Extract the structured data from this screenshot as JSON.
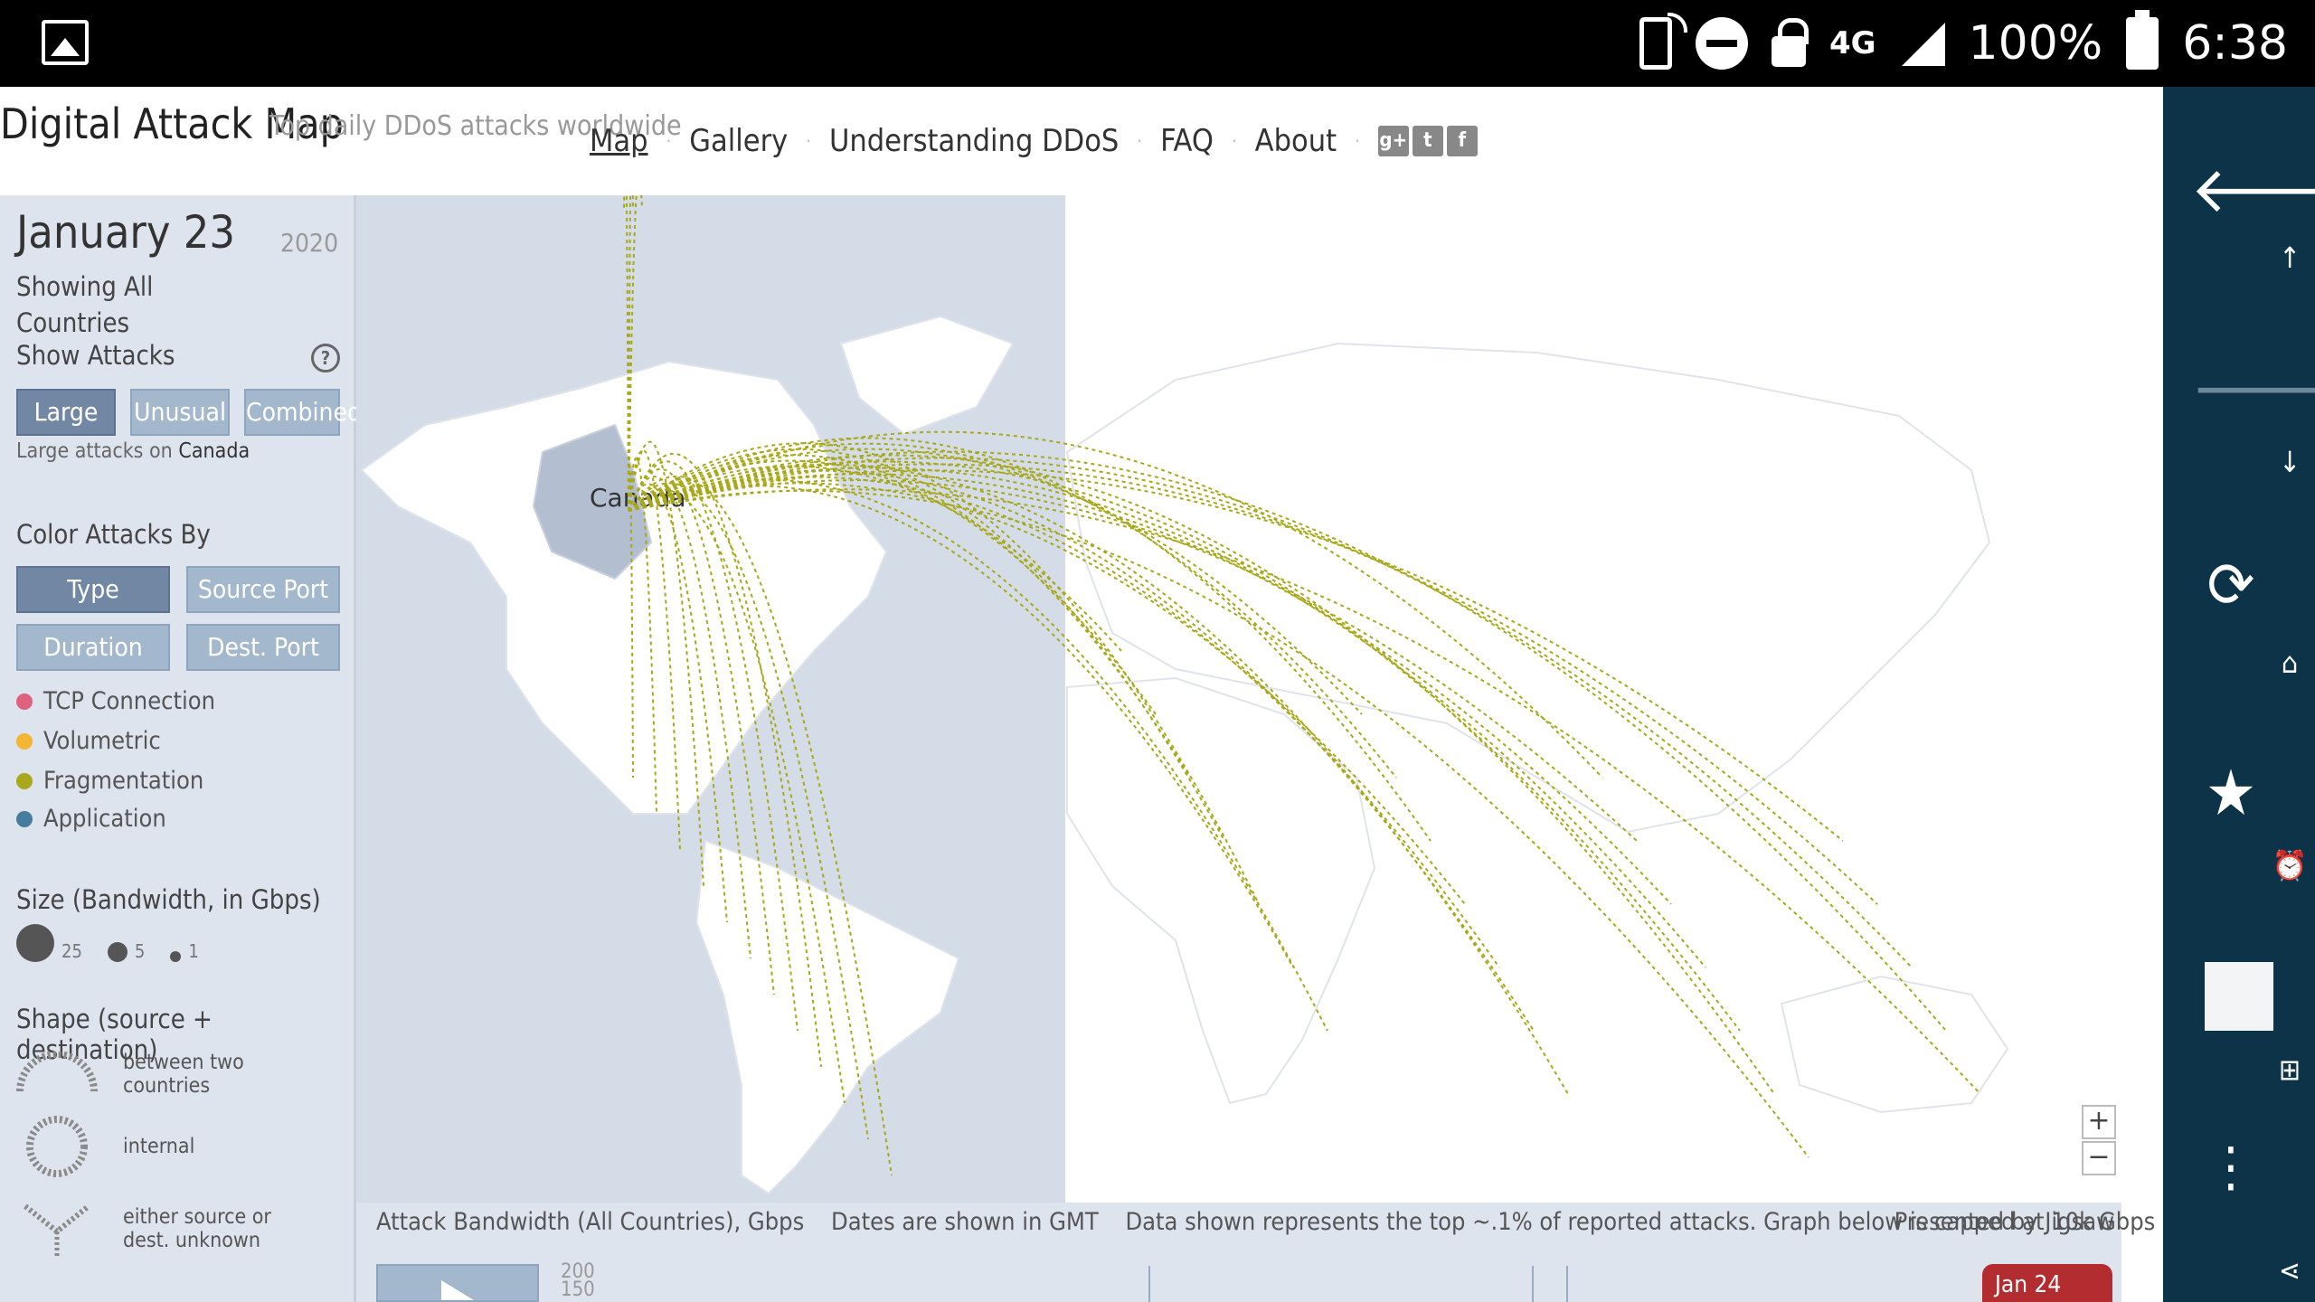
{
  "status_bar": {
    "battery": "100%",
    "time": "6:38",
    "network": "4G"
  },
  "header": {
    "title": "Digital Attack Map",
    "tagline": "Top daily DDoS attacks worldwide",
    "nav": [
      "Map",
      "Gallery",
      "Understanding DDoS",
      "FAQ",
      "About"
    ],
    "social": [
      "g+",
      "t",
      "f"
    ]
  },
  "panel": {
    "date": "January 23",
    "year": "2020",
    "showing": "Showing All",
    "countries": "Countries",
    "show_attacks": "Show Attacks",
    "help": "?",
    "attack_buttons": [
      "Large",
      "Unusual",
      "Combined"
    ],
    "attack_caption_prefix": "Large attacks on",
    "attack_caption_country": "Canada",
    "color_by_title": "Color Attacks By",
    "color_buttons": [
      "Type",
      "Source Port",
      "Duration",
      "Dest. Port"
    ],
    "legend": [
      {
        "label": "TCP Connection",
        "color": "#e0617e"
      },
      {
        "label": "Volumetric",
        "color": "#f2b632"
      },
      {
        "label": "Fragmentation",
        "color": "#a8a81a"
      },
      {
        "label": "Application",
        "color": "#467d9e"
      }
    ],
    "size_title": "Size (Bandwidth, in Gbps)",
    "sizes": [
      "25",
      "5",
      "1"
    ],
    "shape_title": "Shape (source + destination)",
    "shapes": [
      {
        "line1": "between two",
        "line2": "countries"
      },
      {
        "line1": "internal",
        "line2": ""
      },
      {
        "line1": "either source or",
        "line2": "dest. unknown"
      }
    ]
  },
  "map": {
    "selected_country": "Canada",
    "arc_color": "#a8a81a",
    "zoom_in": "+",
    "zoom_out": "−"
  },
  "bottom": {
    "chart_title": "Attack Bandwidth (All Countries), Gbps",
    "dates_note": "Dates are shown in GMT",
    "data_note": "Data shown represents the top ~.1% of reported attacks. Graph below is capped at 10k Gbps",
    "presented_by": "Presented by Jigsaw",
    "y_ticks": [
      "200",
      "150"
    ],
    "badge": "Jan 24"
  }
}
